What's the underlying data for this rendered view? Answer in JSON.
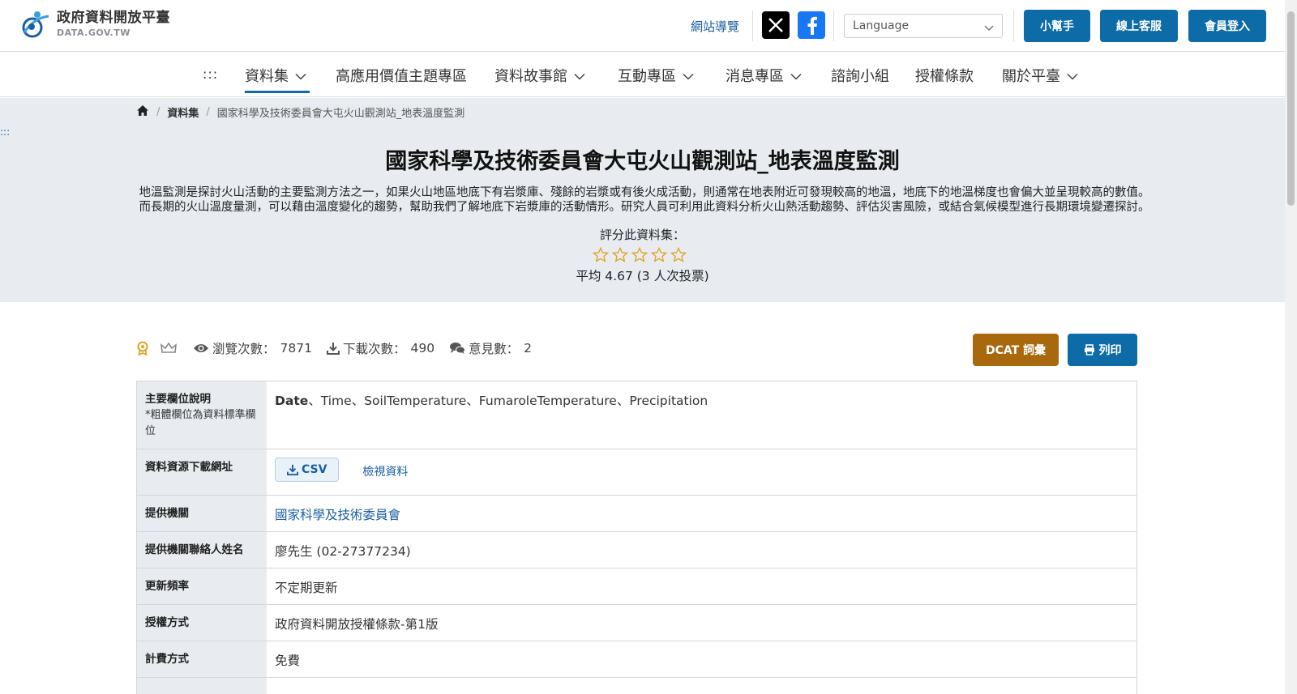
{
  "header": {
    "logo_zh": "政府資料開放平臺",
    "logo_en": "DATA.GOV.TW",
    "sitemap": "網站導覽",
    "language_placeholder": "Language",
    "helper_btn": "小幫手",
    "service_btn": "線上客服",
    "login_btn": "會員登入"
  },
  "nav": {
    "dots": ":::",
    "items": [
      "資料集",
      "高應用價值主題專區",
      "資料故事館",
      "互動專區",
      "消息專區",
      "諮詢小組",
      "授權條款",
      "關於平臺"
    ]
  },
  "breadcrumb": {
    "level1": "資料集",
    "current": "國家科學及技術委員會大屯火山觀測站_地表溫度監測"
  },
  "side_dots": ":::",
  "dataset": {
    "title": "國家科學及技術委員會大屯火山觀測站_地表溫度監測",
    "description_line1": "地溫監測是探討火山活動的主要監測方法之一，如果火山地區地底下有岩漿庫、殘餘的岩漿或有後火成活動，則通常在地表附近可發現較高的地溫，地底下的地溫梯度也會偏大並呈現較高的數值。",
    "description_line2": "而長期的火山溫度量測，可以藉由溫度變化的趨勢，幫助我們了解地底下岩漿庫的活動情形。研究人員可利用此資料分析火山熱活動趨勢、評估災害風險，或結合氣候模型進行長期環境變遷探討。",
    "rate_label": "評分此資料集：",
    "rating_average": "平均 4.67 (3 人次投票)"
  },
  "stats": {
    "views_label": "瀏覽次數：",
    "views": "7871",
    "downloads_label": "下載次數：",
    "downloads": "490",
    "comments_label": "意見數：",
    "comments": "2",
    "dcat_btn": "DCAT 詞彙",
    "print_btn": "列印"
  },
  "table": {
    "fields_label": "主要欄位說明",
    "fields_note": "*粗體欄位為資料標準欄位",
    "field_bold": "Date",
    "field_rest": "、Time、SoilTemperature、FumaroleTemperature、Precipitation",
    "download_label": "資料資源下載網址",
    "csv": "CSV",
    "view_data": "檢視資料",
    "provider_label": "提供機關",
    "provider": "國家科學及技術委員會",
    "contact_label": "提供機關聯絡人姓名",
    "contact": "廖先生 (02-27377234)",
    "frequency_label": "更新頻率",
    "frequency": "不定期更新",
    "license_label": "授權方式",
    "license": "政府資料開放授權條款-第1版",
    "fee_label": "計費方式",
    "fee": "免費"
  },
  "colors": {
    "primary": "#0d6ba8",
    "dcat": "#a8690e",
    "hero_bg": "#e8ecf1",
    "star": "#e0a526"
  },
  "icons": [
    "logo-icon",
    "x-icon",
    "facebook-icon",
    "chevron-down-icon",
    "home-icon",
    "star-icon",
    "badge-icon",
    "crown-icon",
    "eye-icon",
    "download-icon",
    "comments-icon",
    "print-icon"
  ]
}
